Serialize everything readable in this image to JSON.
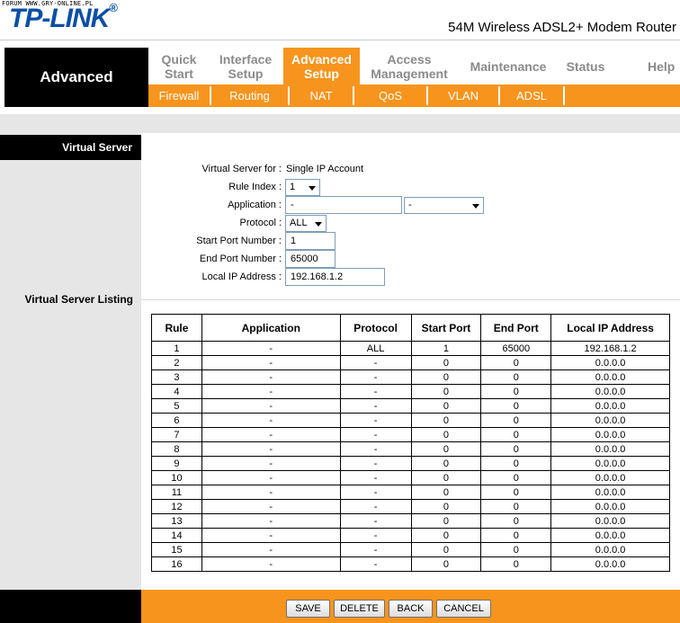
{
  "watermark": "FORUM WWW.GRY-ONLINE.PL",
  "logo": {
    "text": "TP-LINK",
    "mark": "®"
  },
  "product_name": "54M Wireless ADSL2+ Modem Router",
  "section_title": "Advanced",
  "menu": [
    {
      "line1": "Quick",
      "line2": "Start"
    },
    {
      "line1": "Interface",
      "line2": "Setup"
    },
    {
      "line1": "Advanced",
      "line2": "Setup"
    },
    {
      "line1": "Access",
      "line2": "Management"
    },
    {
      "line1": "Maintenance",
      "line2": ""
    },
    {
      "line1": "Status",
      "line2": ""
    },
    {
      "line1": "Help",
      "line2": ""
    }
  ],
  "active_menu": "Advanced Setup",
  "submenu": [
    "Firewall",
    "Routing",
    "NAT",
    "QoS",
    "VLAN",
    "ADSL"
  ],
  "virtual_server": {
    "heading": "Virtual Server",
    "for_label": "Virtual Server for :",
    "for_value": "Single IP Account",
    "rule_index_label": "Rule Index :",
    "rule_index_value": "1",
    "application_label": "Application :",
    "application_value": "-",
    "application_select": "-",
    "protocol_label": "Protocol :",
    "protocol_value": "ALL",
    "start_port_label": "Start Port Number :",
    "start_port_value": "1",
    "end_port_label": "End Port Number :",
    "end_port_value": "65000",
    "local_ip_label": "Local IP Address :",
    "local_ip_value": "192.168.1.2"
  },
  "listing": {
    "heading": "Virtual Server Listing",
    "columns": [
      "Rule",
      "Application",
      "Protocol",
      "Start Port",
      "End Port",
      "Local IP Address"
    ],
    "rows": [
      [
        "1",
        "-",
        "ALL",
        "1",
        "65000",
        "192.168.1.2"
      ],
      [
        "2",
        "-",
        "-",
        "0",
        "0",
        "0.0.0.0"
      ],
      [
        "3",
        "-",
        "-",
        "0",
        "0",
        "0.0.0.0"
      ],
      [
        "4",
        "-",
        "-",
        "0",
        "0",
        "0.0.0.0"
      ],
      [
        "5",
        "-",
        "-",
        "0",
        "0",
        "0.0.0.0"
      ],
      [
        "6",
        "-",
        "-",
        "0",
        "0",
        "0.0.0.0"
      ],
      [
        "7",
        "-",
        "-",
        "0",
        "0",
        "0.0.0.0"
      ],
      [
        "8",
        "-",
        "-",
        "0",
        "0",
        "0.0.0.0"
      ],
      [
        "9",
        "-",
        "-",
        "0",
        "0",
        "0.0.0.0"
      ],
      [
        "10",
        "-",
        "-",
        "0",
        "0",
        "0.0.0.0"
      ],
      [
        "11",
        "-",
        "-",
        "0",
        "0",
        "0.0.0.0"
      ],
      [
        "12",
        "-",
        "-",
        "0",
        "0",
        "0.0.0.0"
      ],
      [
        "13",
        "-",
        "-",
        "0",
        "0",
        "0.0.0.0"
      ],
      [
        "14",
        "-",
        "-",
        "0",
        "0",
        "0.0.0.0"
      ],
      [
        "15",
        "-",
        "-",
        "0",
        "0",
        "0.0.0.0"
      ],
      [
        "16",
        "-",
        "-",
        "0",
        "0",
        "0.0.0.0"
      ]
    ]
  },
  "buttons": {
    "save": "SAVE",
    "delete": "DELETE",
    "back": "BACK",
    "cancel": "CANCEL"
  },
  "colors": {
    "accent": "#f7941d",
    "logo": "#0b4fa5",
    "menu_text": "#8a8a8a",
    "panel": "#e6e6e6"
  }
}
